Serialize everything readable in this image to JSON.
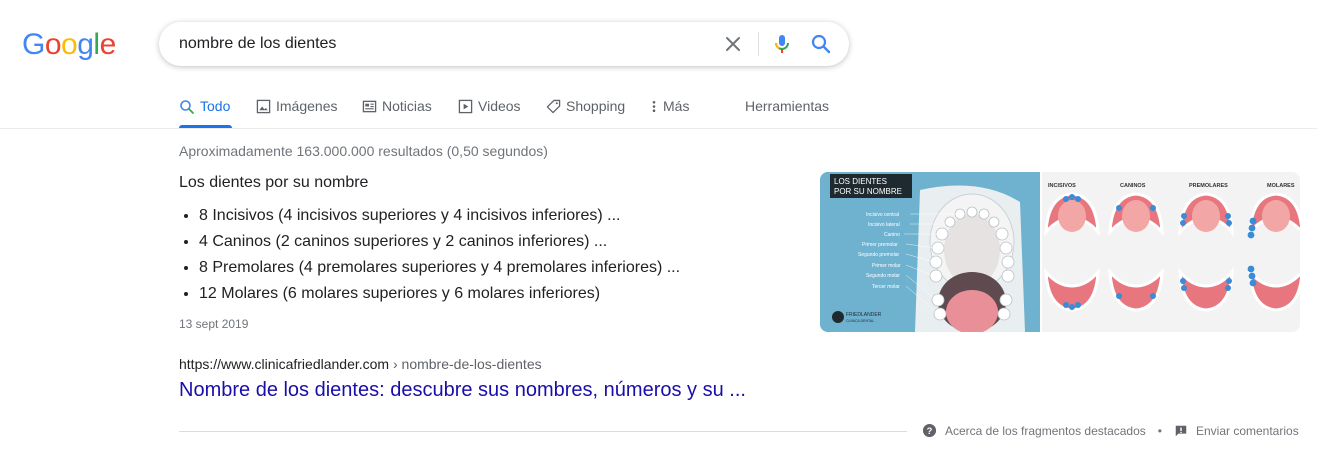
{
  "logo": {
    "letters": [
      "G",
      "o",
      "o",
      "g",
      "l",
      "e"
    ],
    "colors": [
      "#4285f4",
      "#ea4335",
      "#fbbc05",
      "#4285f4",
      "#34a853",
      "#ea4335"
    ]
  },
  "search": {
    "query": "nombre de los dientes"
  },
  "icons": {
    "clear": "close-icon",
    "mic": "microphone-icon",
    "search": "search-icon"
  },
  "tabs": [
    {
      "label": "Todo",
      "icon": "search-icon",
      "active": true
    },
    {
      "label": "Imágenes",
      "icon": "image-icon"
    },
    {
      "label": "Noticias",
      "icon": "news-icon"
    },
    {
      "label": "Videos",
      "icon": "play-icon"
    },
    {
      "label": "Shopping",
      "icon": "tag-icon"
    },
    {
      "label": "Más",
      "icon": "more-vert-icon"
    }
  ],
  "tools_label": "Herramientas",
  "stats": "Aproximadamente 163.000.000 resultados (0,50 segundos)",
  "snippet": {
    "title": "Los dientes por su nombre",
    "items": [
      "8 Incisivos (4 incisivos superiores y 4 incisivos inferiores) ...",
      "4 Caninos (2 caninos superiores y 2 caninos inferiores) ...",
      "8 Premolares (4 premolares superiores y 4 premolares inferiores) ...",
      "12 Molares (6 molares superiores y 6 molares inferiores)"
    ],
    "date": "13 sept 2019"
  },
  "result": {
    "url": "https://www.clinicafriedlander.com",
    "crumb": " › nombre-de-los-dientes",
    "title": "Nombre de los dientes: descubre sus nombres, números y su ..."
  },
  "images": {
    "image1": {
      "heading": [
        "LOS DIENTES",
        "POR SU NOMBRE"
      ],
      "labels": [
        "Incisivo central",
        "Incisivo lateral",
        "Canino",
        "Primer premolar",
        "Segundo premolar",
        "Primer molar",
        "Segundo molar",
        "Tercer molar"
      ],
      "brand": "FRIEDLANDER",
      "brand_sub": "CLÍNICA DENTAL"
    },
    "image2": {
      "labels": [
        "INCISIVOS",
        "CANINOS",
        "PREMOLARES",
        "MOLARES"
      ]
    }
  },
  "feedback": {
    "about": "Acerca de los fragmentos destacados",
    "separator": "•",
    "send": "Enviar comentarios"
  },
  "colors": {
    "accent": "#1a73e8",
    "link": "#1a0dab",
    "muted": "#70757a"
  }
}
